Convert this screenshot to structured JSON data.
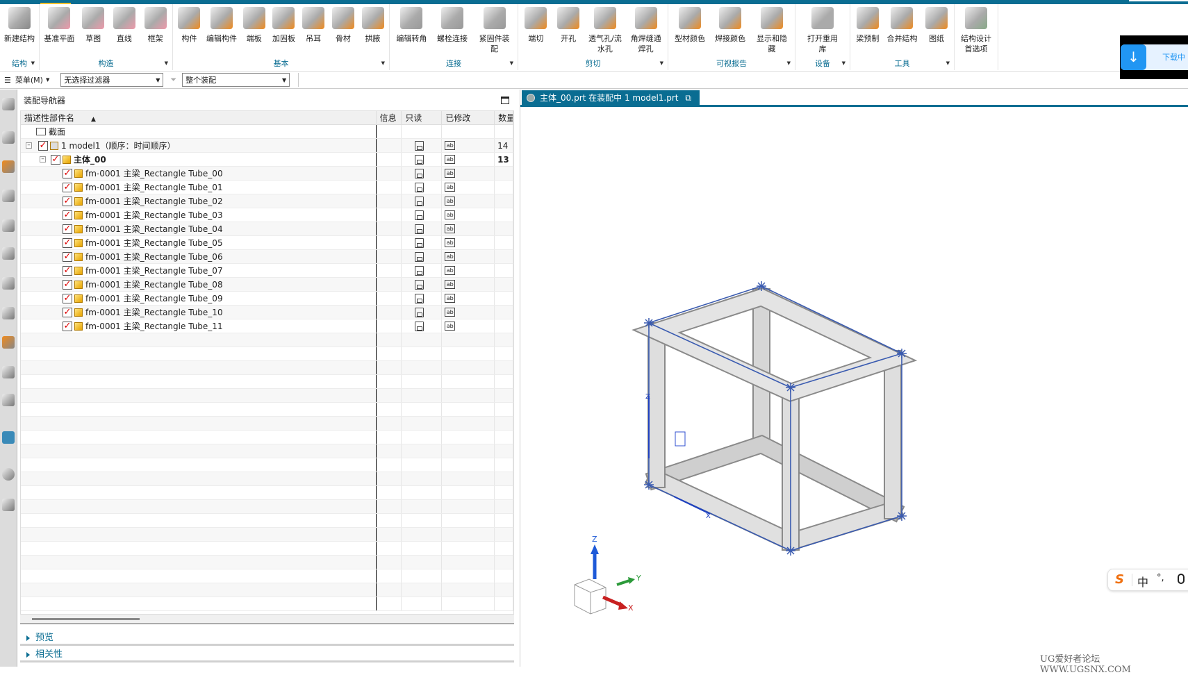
{
  "ribbon": {
    "groups": [
      {
        "label": "结构",
        "items": [
          "新建结构"
        ]
      },
      {
        "label": "构造",
        "items": [
          "基准平面",
          "草图",
          "直线",
          "框架"
        ]
      },
      {
        "label": "基本",
        "items": [
          "构件",
          "编辑构件",
          "端板",
          "加固板",
          "吊耳",
          "骨材",
          "拱腋"
        ]
      },
      {
        "label": "连接",
        "items": [
          "编辑转角",
          "螺栓连接",
          "紧固件装配"
        ]
      },
      {
        "label": "剪切",
        "items": [
          "端切",
          "开孔",
          "透气孔/流水孔",
          "角焊缝通焊孔"
        ]
      },
      {
        "label": "可视报告",
        "items": [
          "型材颜色",
          "焊接颜色",
          "显示和隐藏"
        ]
      },
      {
        "label": "设备",
        "items": [
          "打开重用库"
        ]
      },
      {
        "label": "工具",
        "items": [
          "梁预制",
          "合并结构",
          "图纸"
        ]
      },
      {
        "label": "",
        "items": [
          "结构设计首选项"
        ]
      }
    ]
  },
  "toolbar": {
    "menu": "菜单(M)",
    "filter": "无选择过滤器",
    "scope": "整个装配"
  },
  "navigator": {
    "title": "装配导航器",
    "columns": [
      "描述性部件名",
      "信息",
      "只读",
      "已修改",
      "数量"
    ],
    "rows": [
      {
        "name": "截面",
        "level": 0,
        "type": "folder"
      },
      {
        "name": "1 model1（顺序：时间顺序）",
        "level": 1,
        "type": "assembly",
        "count": "14"
      },
      {
        "name": "主体_00",
        "level": 2,
        "type": "subassembly",
        "count": "13",
        "bold": true
      },
      {
        "name": "fm-0001 主梁_Rectangle Tube_00",
        "level": 3,
        "type": "part"
      },
      {
        "name": "fm-0001 主梁_Rectangle Tube_01",
        "level": 3,
        "type": "part"
      },
      {
        "name": "fm-0001 主梁_Rectangle Tube_02",
        "level": 3,
        "type": "part"
      },
      {
        "name": "fm-0001 主梁_Rectangle Tube_03",
        "level": 3,
        "type": "part"
      },
      {
        "name": "fm-0001 主梁_Rectangle Tube_04",
        "level": 3,
        "type": "part"
      },
      {
        "name": "fm-0001 主梁_Rectangle Tube_05",
        "level": 3,
        "type": "part"
      },
      {
        "name": "fm-0001 主梁_Rectangle Tube_06",
        "level": 3,
        "type": "part"
      },
      {
        "name": "fm-0001 主梁_Rectangle Tube_07",
        "level": 3,
        "type": "part"
      },
      {
        "name": "fm-0001 主梁_Rectangle Tube_08",
        "level": 3,
        "type": "part"
      },
      {
        "name": "fm-0001 主梁_Rectangle Tube_09",
        "level": 3,
        "type": "part"
      },
      {
        "name": "fm-0001 主梁_Rectangle Tube_10",
        "level": 3,
        "type": "part"
      },
      {
        "name": "fm-0001 主梁_Rectangle Tube_11",
        "level": 3,
        "type": "part"
      }
    ],
    "modified_glyph": "ab",
    "sections": [
      "预览",
      "相关性"
    ]
  },
  "graphics": {
    "tab": "主体_00.prt 在装配中 1 model1.prt",
    "axes": {
      "x": "X",
      "y": "Y",
      "z": "Z"
    },
    "model_axes": {
      "z": "Z",
      "x": "X"
    }
  },
  "overlay": {
    "download": "下载中",
    "ime": [
      "中",
      "°,"
    ]
  },
  "watermark": "UG爱好者论坛 WWW.UGSNX.COM",
  "colors": {
    "accent": "#0a6d92",
    "orange": "#f08a1c",
    "frame_edge": "#3a5bb0"
  }
}
